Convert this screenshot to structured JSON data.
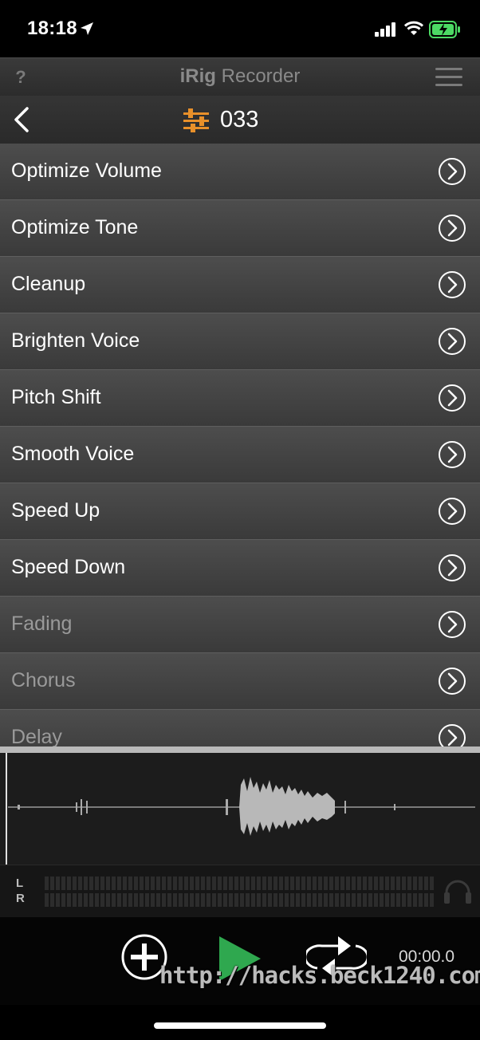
{
  "status_bar": {
    "time": "18:18",
    "icons": [
      "location-arrow-icon",
      "signal-icon",
      "wifi-icon",
      "battery-charging-icon"
    ]
  },
  "app_header": {
    "help_label": "?",
    "title_brand": "iRig",
    "title_rest": " Recorder",
    "menu_icon": "hamburger-menu-icon"
  },
  "nav": {
    "back_icon": "chevron-left-icon",
    "title_icon": "sliders-icon",
    "title": "033"
  },
  "effects": [
    {
      "label": "Optimize Volume",
      "enabled": true
    },
    {
      "label": "Optimize Tone",
      "enabled": true
    },
    {
      "label": "Cleanup",
      "enabled": true
    },
    {
      "label": "Brighten Voice",
      "enabled": true
    },
    {
      "label": "Pitch Shift",
      "enabled": true
    },
    {
      "label": "Smooth Voice",
      "enabled": true
    },
    {
      "label": "Speed Up",
      "enabled": true
    },
    {
      "label": "Speed Down",
      "enabled": true
    },
    {
      "label": "Fading",
      "enabled": false
    },
    {
      "label": "Chorus",
      "enabled": false
    },
    {
      "label": "Delay",
      "enabled": false
    }
  ],
  "meter": {
    "left_label": "L",
    "right_label": "R"
  },
  "transport": {
    "add_icon": "plus-circle-icon",
    "play_icon": "play-icon",
    "loop_icon": "loop-icon",
    "time": "00:00.0"
  },
  "watermark": "http://hacks.beck1240.com/",
  "colors": {
    "accent_orange": "#e8902a",
    "play_green": "#2fa84f",
    "battery_green": "#4cd964"
  }
}
